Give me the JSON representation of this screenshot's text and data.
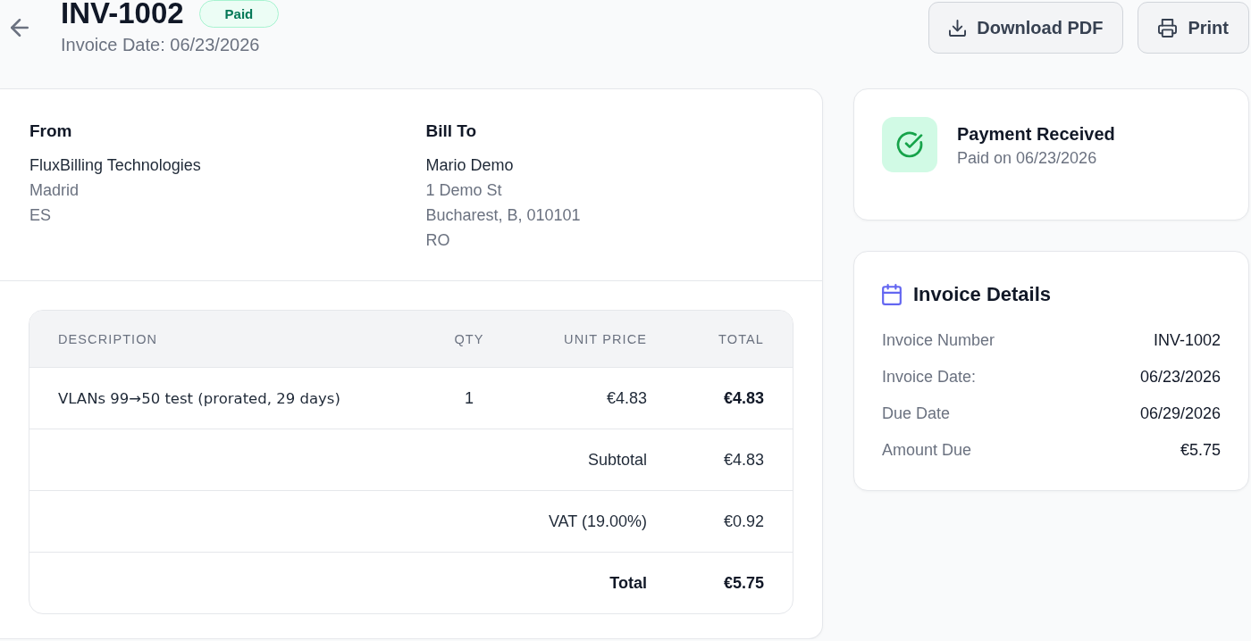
{
  "header": {
    "title": "INV-1002",
    "status_badge": "Paid",
    "subtitle": "Invoice Date: 06/23/2026"
  },
  "actions": [
    {
      "label": "Download PDF",
      "kind": "download"
    },
    {
      "label": "Print",
      "kind": "print"
    }
  ],
  "parties": [
    {
      "heading": "From",
      "name": "FluxBilling Technologies",
      "lines": [
        "Madrid",
        "ES"
      ]
    },
    {
      "heading": "Bill To",
      "name": "Mario Demo",
      "lines": [
        "1 Demo St",
        "Bucharest, B, 010101",
        "RO"
      ]
    }
  ],
  "items_table": {
    "columns": [
      "DESCRIPTION",
      "QTY",
      "UNIT PRICE",
      "TOTAL"
    ],
    "rows": [
      {
        "description": "VLANs 99→50 test (prorated, 29 days)",
        "qty": "1",
        "unit_price": "€4.83",
        "total": "€4.83"
      }
    ],
    "summary": [
      {
        "label": "Subtotal",
        "value": "€4.83",
        "kind": "normal"
      },
      {
        "label": "VAT (19.00%)",
        "value": "€0.92",
        "kind": "normal"
      },
      {
        "label": "Total",
        "value": "€5.75",
        "kind": "emphasis"
      }
    ]
  },
  "payment_status": {
    "title": "Payment Received",
    "subtitle": "Paid on 06/23/2026"
  },
  "invoice_details": {
    "title": "Invoice Details",
    "rows": [
      {
        "label": "Invoice Number",
        "value": "INV-1002"
      },
      {
        "label": "Invoice Date:",
        "value": "06/23/2026"
      },
      {
        "label": "Due Date",
        "value": "06/29/2026"
      },
      {
        "label": "Amount Due",
        "value": "€5.75"
      }
    ]
  }
}
